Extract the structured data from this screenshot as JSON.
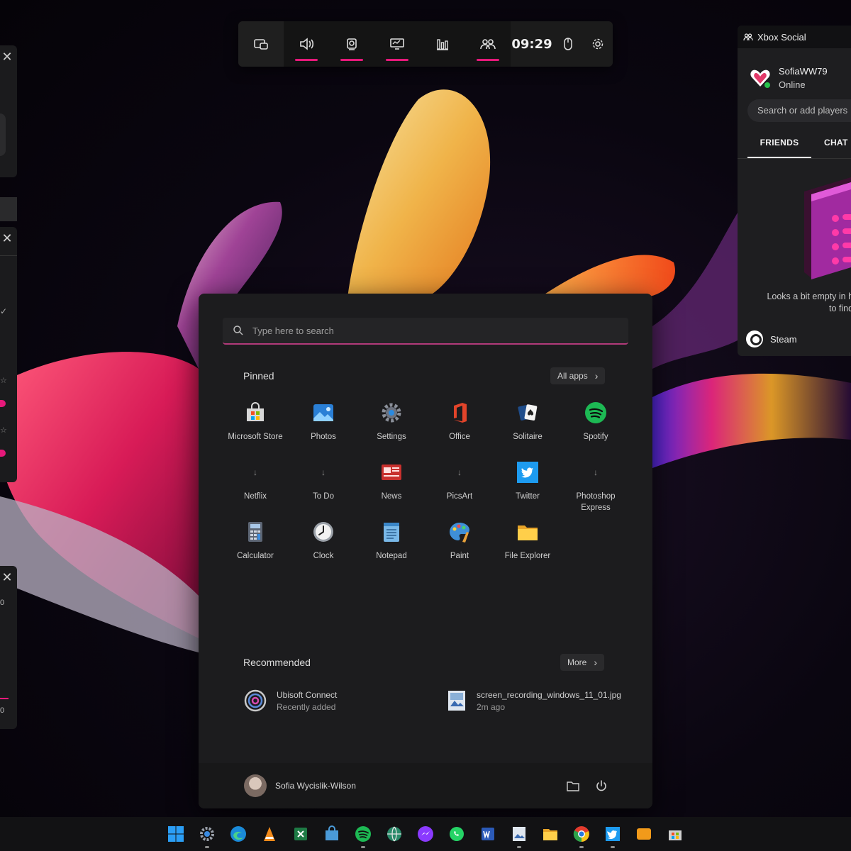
{
  "gamebar": {
    "time": "09:29",
    "buttons": [
      "widget-menu-icon",
      "audio-icon",
      "capture-icon",
      "performance-icon",
      "resources-icon",
      "xbox-social-icon"
    ]
  },
  "social": {
    "title": "Xbox Social",
    "username": "SofiaWW79",
    "status": "Online",
    "search_placeholder": "Search or add players",
    "tabs": [
      "FRIENDS",
      "CHAT"
    ],
    "empty_line1": "Looks a bit empty in he",
    "empty_line2": "to find f",
    "steam_label": "Steam"
  },
  "start": {
    "search_placeholder": "Type here to search",
    "pinned_title": "Pinned",
    "all_apps_label": "All apps",
    "apps": [
      {
        "label": "Microsoft Store",
        "icon": "store-icon"
      },
      {
        "label": "Photos",
        "icon": "photos-icon"
      },
      {
        "label": "Settings",
        "icon": "settings-icon"
      },
      {
        "label": "Office",
        "icon": "office-icon"
      },
      {
        "label": "Solitaire",
        "icon": "solitaire-icon"
      },
      {
        "label": "Spotify",
        "icon": "spotify-icon"
      },
      {
        "label": "Netflix",
        "icon": "download-icon"
      },
      {
        "label": "To Do",
        "icon": "download-icon"
      },
      {
        "label": "News",
        "icon": "news-icon"
      },
      {
        "label": "PicsArt",
        "icon": "download-icon"
      },
      {
        "label": "Twitter",
        "icon": "twitter-icon"
      },
      {
        "label": "Photoshop Express",
        "icon": "download-icon"
      },
      {
        "label": "Calculator",
        "icon": "calculator-icon"
      },
      {
        "label": "Clock",
        "icon": "clock-icon"
      },
      {
        "label": "Notepad",
        "icon": "notepad-icon"
      },
      {
        "label": "Paint",
        "icon": "paint-icon"
      },
      {
        "label": "File Explorer",
        "icon": "folder-icon"
      }
    ],
    "recommended_title": "Recommended",
    "more_label": "More",
    "recommended": [
      {
        "title": "Ubisoft Connect",
        "subtitle": "Recently added"
      },
      {
        "title": "screen_recording_windows_11_01.jpg",
        "subtitle": "2m ago"
      }
    ],
    "user_name": "Sofia Wycislik-Wilson"
  },
  "left_widgets": {
    "values": [
      "0",
      "0"
    ]
  },
  "colors": {
    "accent": "#e6197a",
    "panel": "#1c1c1e",
    "taskbar": "#121214"
  }
}
